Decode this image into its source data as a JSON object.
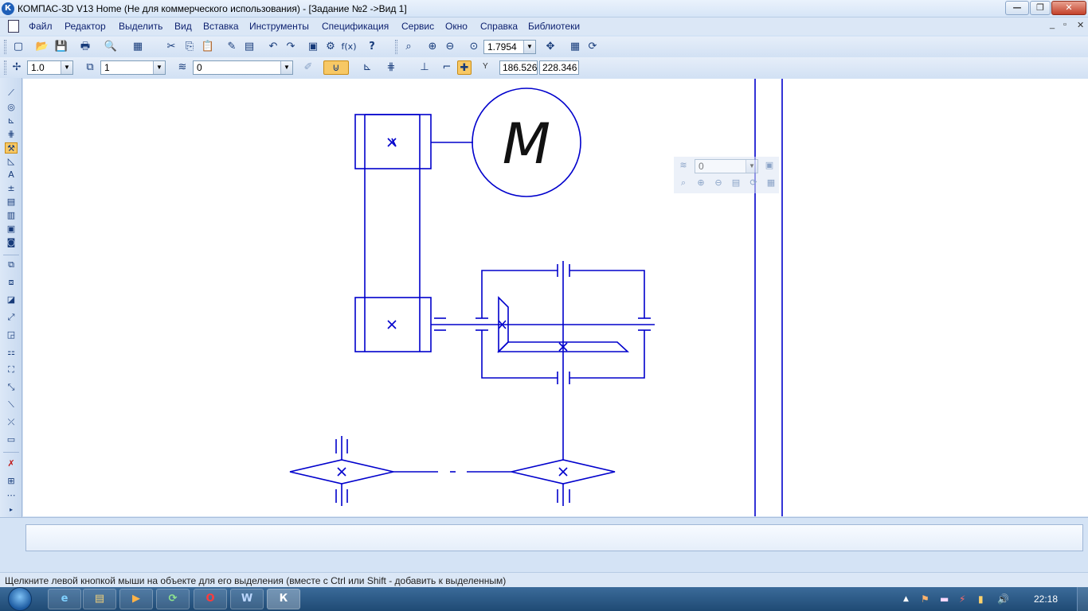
{
  "window": {
    "app_icon": "К",
    "title": "КОМПАС-3D V13 Home (Не для коммерческого использования) - [Задание №2 ->Вид 1]",
    "minimize": "—",
    "maximize": "❐",
    "close": "✕"
  },
  "menu": {
    "items": [
      "Файл",
      "Редактор",
      "Выделить",
      "Вид",
      "Вставка",
      "Инструменты",
      "Спецификация",
      "Сервис",
      "Окно",
      "Справка",
      "Библиотеки"
    ],
    "mdi_min": "_",
    "mdi_restore": "▫",
    "mdi_close": "✕"
  },
  "toolbar1": {
    "icons": {
      "new": "▢",
      "open": "📂",
      "save": "💾",
      "print": "🖶",
      "preview": "🔍",
      "manager": "▦",
      "cut": "✂",
      "copy": "⎘",
      "paste": "📋",
      "format": "✎",
      "props": "▤",
      "undo": "↶",
      "redo": "↷",
      "tree": "▣",
      "params": "⚙",
      "fx": "f(x)",
      "help": "?",
      "zoom_show": "⌕",
      "zoom_in": "⊕",
      "zoom_out": "⊖",
      "zoom_fit": "⊙",
      "pan": "✥",
      "refresh": "⟳",
      "extra": "▦"
    },
    "scale_value": "1.7954"
  },
  "toolbar2": {
    "snap_step_value": "1.0",
    "layer_value": "1",
    "style_value": "0",
    "coord_x_label": "Y",
    "coord_x": "186.526",
    "coord_y": "228.346",
    "icons": {
      "snap": "✢",
      "layer": "⧉",
      "style": "≋",
      "brush": "✐",
      "magnet": "⊍",
      "ortho": "⊾",
      "grid": "⋕",
      "local": "⊥",
      "round": "⌐",
      "snap_on": "✚"
    }
  },
  "left_toolbar": {
    "icons": [
      "⟋",
      "◎",
      "⊾",
      "⋕",
      "⚒",
      "◺",
      "A",
      "±",
      "▤",
      "▥",
      "▣",
      "◙",
      "⧉",
      "⧈",
      "◪",
      "⤢",
      "◲",
      "⚏",
      "⛶",
      "⤡",
      "⟍",
      "⤫",
      "▭",
      "✗",
      "⊞",
      "⋯",
      "▸"
    ]
  },
  "drawing": {
    "motor_label": "M",
    "color": "#0000cc"
  },
  "ghost_toolbar": {
    "combo_value": "0"
  },
  "status": {
    "hint": "Щелкните левой кнопкой мыши на объекте для его выделения (вместе с Ctrl или Shift - добавить к выделенным)"
  },
  "taskbar": {
    "clock": "22:18",
    "tasks": [
      "e",
      "▤",
      "▶",
      "⟳",
      "O",
      "W",
      "К"
    ],
    "tray": [
      "▲",
      "⚑",
      "▬",
      "⚡",
      "▮",
      "🔊"
    ]
  }
}
